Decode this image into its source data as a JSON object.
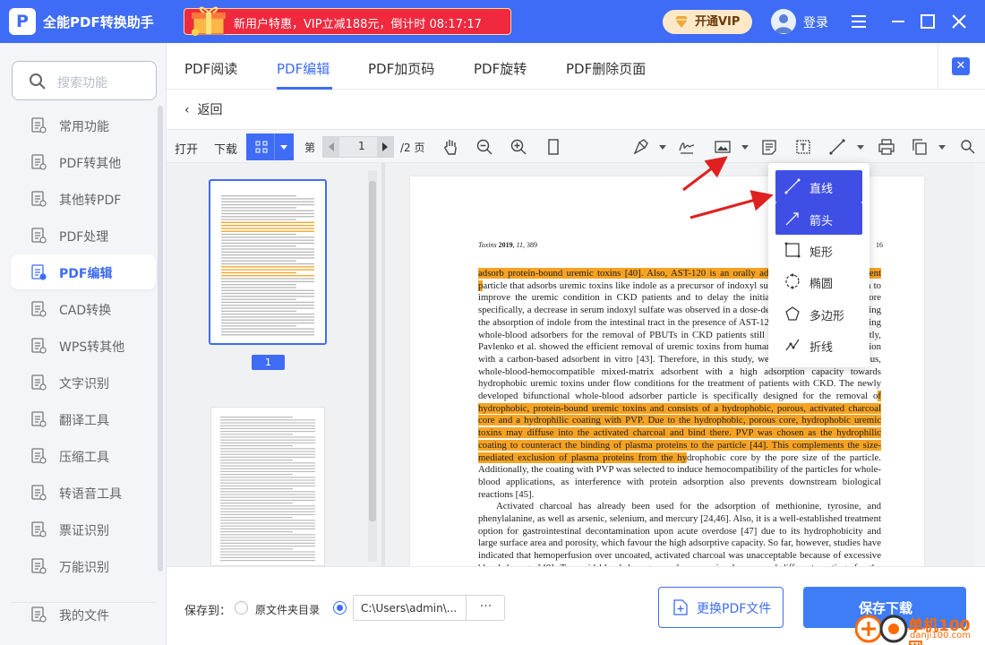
{
  "app": {
    "title": "全能PDF转换助手",
    "logo_letter": "P"
  },
  "promo": {
    "text": "新用户特惠，VIP立减188元，倒计时 08:17:17"
  },
  "header": {
    "vip_label": "开通VIP",
    "login_label": "登录"
  },
  "sidebar": {
    "search_placeholder": "搜索功能",
    "items": [
      {
        "label": "常用功能",
        "icon": "common-tools-icon"
      },
      {
        "label": "PDF转其他",
        "icon": "pdf-convert-icon"
      },
      {
        "label": "其他转PDF",
        "icon": "to-pdf-icon"
      },
      {
        "label": "PDF处理",
        "icon": "pdf-process-icon"
      },
      {
        "label": "PDF编辑",
        "icon": "pdf-edit-icon"
      },
      {
        "label": "CAD转换",
        "icon": "cad-icon"
      },
      {
        "label": "WPS转其他",
        "icon": "wps-icon"
      },
      {
        "label": "文字识别",
        "icon": "ocr-icon"
      },
      {
        "label": "翻译工具",
        "icon": "translate-icon"
      },
      {
        "label": "压缩工具",
        "icon": "compress-icon"
      },
      {
        "label": "转语音工具",
        "icon": "speech-icon"
      },
      {
        "label": "票证识别",
        "icon": "ticket-icon"
      },
      {
        "label": "万能识别",
        "icon": "universal-ocr-icon"
      },
      {
        "label": "我的文件",
        "icon": "my-files-icon"
      }
    ],
    "active_index": 4
  },
  "tabs": [
    {
      "label": "PDF阅读"
    },
    {
      "label": "PDF编辑"
    },
    {
      "label": "PDF加页码"
    },
    {
      "label": "PDF旋转"
    },
    {
      "label": "PDF删除页面"
    }
  ],
  "back_label": "返回",
  "toolbar": {
    "open_label": "打开",
    "download_label": "下载",
    "page_prefix": "第",
    "page_current": "1",
    "page_total": "/2 页"
  },
  "thumbnails": {
    "badge": "1"
  },
  "dropdown": {
    "items": [
      {
        "label": "直线",
        "icon": "line-icon",
        "selected": true
      },
      {
        "label": "箭头",
        "icon": "arrow-icon",
        "selected": true
      },
      {
        "label": "矩形",
        "icon": "rectangle-icon",
        "selected": false
      },
      {
        "label": "椭圆",
        "icon": "ellipse-icon",
        "selected": false
      },
      {
        "label": "多边形",
        "icon": "polygon-icon",
        "selected": false
      },
      {
        "label": "折线",
        "icon": "polyline-icon",
        "selected": false
      }
    ]
  },
  "document": {
    "journal": "Toxins",
    "year": "2019",
    "volume": "11",
    "article": "389",
    "page_of": "16",
    "paragraph1": [
      {
        "t": "adsorb protein-bound uremic toxins [40]. Also, AST-120 is an orally admi",
        "hl": true
      },
      {
        "t": "nistered ",
        "hl": false
      },
      {
        "t": "carbon adsorbent p",
        "hl": true
      },
      {
        "t": "article that adsorbs uremic toxins like indole as a p",
        "hl": false
      },
      {
        "t": "recursor of indoxyl sulfate. AST-120 was shown to improve the uremic condition in CKD patients and to delay the initiation of hemodialysis. More specifically, a decrease in serum indoxyl sulfate was observed in a dose-dependent manner by reducing the absorption of indole from the intestinal tract in the presence of AST-120 [41,42]. However, creating whole-blood adsorbers for the removal of PBUTs in CKD patients still poses a challenge. Recently, Pavlenko et al. showed the efficient removal of uremic toxins from human plasma after 4 h incubation with a carbon-based adsorbent in vitro [43]. Therefore, in this study, we developed a highly porous, whole-blood-hemocompatible mixed-matrix adsorbent with a high adsorption capacity towards hydrophobic uremic toxins under flow conditions for the treatment of patients with CKD. The newly developed bifunctional whole-blood adsorber particle is specifically designed for the removal o",
        "hl": false
      },
      {
        "t": "f hydrophobic, protein-bound uremic toxins and consists of a hydrophobic, porous, activated charcoal core and a hydrophilic coating with PVP. Due to the hydrophobic, porous core, hydrophobic uremic toxins may diffuse into the activated charcoal and bind there. PVP was chosen as the hydrophilic coating to counteract the binding of plasma proteins to the particle [44]. This complements the size-mediated exclusion of plasma proteins from the hy",
        "hl": true
      },
      {
        "t": "drophobic core by the pore size of the particle. Additionally, the coating with PVP was selected to induce hemocompatibility of the particles for whole-blood applications, as interference with protein adsorption also prevents downstream biological reactions [45].",
        "hl": false
      }
    ],
    "paragraph2": "Activated charcoal has already been used for the adsorption of methionine, tyrosine, and phenylalanine, as well as arsenic, selenium, and mercury [24,46]. Also, it is a well-established treatment option for gastrointestinal decontamination upon acute overdose [47] due to its hydrophobicity and large surface area and porosity, which favour the high adsorptive capacity. So far, however, studies have indicated that hemoperfusion over uncoated, activated charcoal was unacceptable because of excessive blood damage [48]. To avoid blood damage, we have previously screened different coatings for the activated charcoal (data not shown). From that screening, we selected PVP for the coating in this"
  },
  "footer": {
    "save_to_label": "保存到：",
    "option_source": "原文件夹目录",
    "path_value": "C:\\Users\\admin\\...",
    "path_dots": "···",
    "replace_label": "更换PDF文件",
    "save_label": "保存下载"
  },
  "watermark": {
    "site": "单机100网",
    "url": "danji100.com"
  },
  "colors": {
    "primary": "#3f6cf6",
    "highlight": "#f6a323",
    "promo": "#f0293e",
    "annotation_arrow": "#e02020"
  }
}
